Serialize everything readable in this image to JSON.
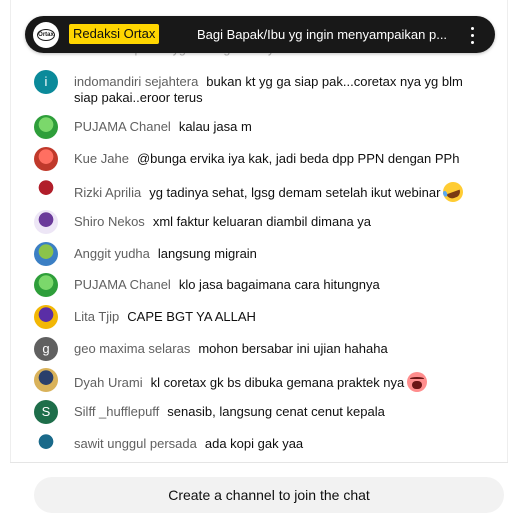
{
  "pinned": {
    "avatar_text": "Ortax",
    "author": "Redaksi Ortax",
    "text": "Bagi Bapak/Ibu yg ingin menyampaikan p...",
    "menu_icon": "more-vert-icon"
  },
  "ghost_message": {
    "text": "ini ada di aplikasi yg sama gimana ya"
  },
  "messages": [
    {
      "author": "indomandiri sejahtera",
      "text": "bukan kt yg ga siap pak...coretax nya yg blm siap pakai..eroor terus",
      "avatar": {
        "type": "letter",
        "letter": "i",
        "color": "#0b8a9a"
      }
    },
    {
      "author": "PUJAMA Chanel",
      "text": "kalau jasa m",
      "avatar": {
        "type": "image",
        "colors": [
          "#2e9e3a",
          "#7bd86b"
        ]
      }
    },
    {
      "author": "Kue Jahe",
      "text": "@bunga ervika iya kak, jadi beda dpp PPN dengan PPh",
      "avatar": {
        "type": "image",
        "colors": [
          "#c0392b",
          "#ff6f61"
        ]
      }
    },
    {
      "author": "Rizki Aprilia",
      "text": "yg tadinya sehat, lgsg demam setelah ikut webinar",
      "emoji": "rolling-laughing-emoji",
      "avatar": {
        "type": "image",
        "colors": [
          "#ffffff",
          "#b11e2a"
        ]
      }
    },
    {
      "author": "Shiro Nekos",
      "text": "xml faktur keluaran diambil dimana ya",
      "avatar": {
        "type": "image",
        "colors": [
          "#ede6f6",
          "#6a3a9a"
        ]
      }
    },
    {
      "author": "Anggit yudha",
      "text": "langsung migrain",
      "avatar": {
        "type": "image",
        "colors": [
          "#3b7fc4",
          "#8bc34a"
        ]
      }
    },
    {
      "author": "PUJAMA Chanel",
      "text": "klo jasa bagaimana cara hitungnya",
      "avatar": {
        "type": "image",
        "colors": [
          "#2e9e3a",
          "#7bd86b"
        ]
      }
    },
    {
      "author": "Lita Tjip",
      "text": "CAPE BGT YA ALLAH",
      "avatar": {
        "type": "image",
        "colors": [
          "#f2b705",
          "#5a2ea6"
        ]
      }
    },
    {
      "author": "geo maxima selaras",
      "text": "mohon bersabar ini ujian hahaha",
      "avatar": {
        "type": "letter",
        "letter": "g",
        "color": "#606060"
      }
    },
    {
      "author": "Dyah Urami",
      "text": "kl coretax gk bs dibuka gemana praktek nya",
      "emoji": "crying-face-emoji",
      "avatar": {
        "type": "image",
        "colors": [
          "#d9b25a",
          "#2a3f6b"
        ]
      }
    },
    {
      "author": "Silff _hufflepuff",
      "text": "senasib, langsung cenat cenut kepala",
      "avatar": {
        "type": "letter",
        "letter": "S",
        "color": "#1e6e4a"
      }
    },
    {
      "author": "sawit unggul persada",
      "text": "ada kopi gak yaa",
      "avatar": {
        "type": "image",
        "colors": [
          "#ffffff",
          "#1a6a8a"
        ]
      }
    }
  ],
  "footer": {
    "join_label": "Create a channel to join the chat"
  }
}
